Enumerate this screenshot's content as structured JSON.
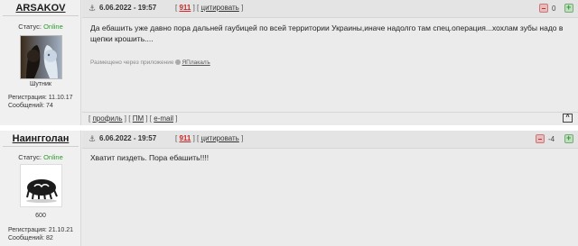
{
  "posts": [
    {
      "author": {
        "name": "ARSAKOV",
        "status_label": "Статус: ",
        "status_value": "Online",
        "rank": "Шутник",
        "reg": "Регистрация: 11.10.17",
        "msgs": "Сообщений: 74"
      },
      "date": "6.06.2022 - 19:57",
      "num": "911",
      "quote_label": "цитировать",
      "score": "0",
      "text": "Да ебашить уже давно пора дальней гаубицей по всей территории Украины,иначе надолго там спец.операция...хохлам зубы надо в щепки крошить....",
      "via_label": "Размещено через приложение",
      "via_app": "ЯПлакалъ",
      "footer": {
        "profile": "профиль",
        "pm": "ПМ",
        "email": "e-mail"
      },
      "top_label": "^"
    },
    {
      "author": {
        "name": "Наингголан",
        "status_label": "Статус: ",
        "status_value": "Online",
        "rank": "600",
        "reg": "Регистрация: 21.10.21",
        "msgs": "Сообщений: 82"
      },
      "date": "6.06.2022 - 19:57",
      "num": "911",
      "quote_label": "цитировать",
      "score": "-4",
      "text": "Хватит пиздеть. Пора ебашить!!!!"
    }
  ],
  "colors": {
    "online": "#2e9a2e",
    "post_number": "#c82828",
    "panel_bg": "#ebebeb"
  },
  "icons": {
    "anchor": "anchor-icon",
    "minus": "vote-minus-icon",
    "plus": "vote-plus-icon"
  }
}
